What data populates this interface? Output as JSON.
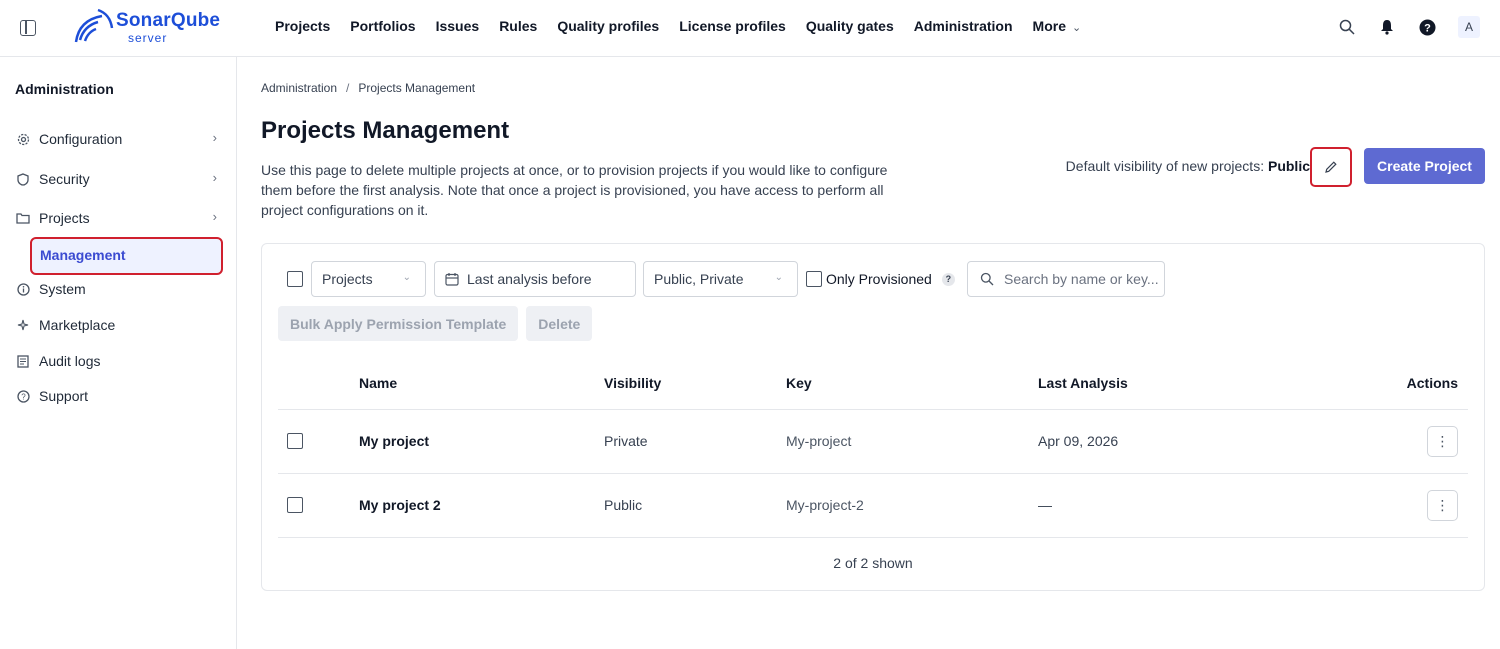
{
  "header": {
    "logo_text": "SonarQube",
    "logo_sub": "server",
    "nav": [
      "Projects",
      "Portfolios",
      "Issues",
      "Rules",
      "Quality profiles",
      "License profiles",
      "Quality gates",
      "Administration"
    ],
    "more_label": "More",
    "avatar_letter": "A"
  },
  "sidebar": {
    "title": "Administration",
    "items": [
      {
        "label": "Configuration",
        "icon": "gear-icon"
      },
      {
        "label": "Security",
        "icon": "shield-icon"
      },
      {
        "label": "Projects",
        "icon": "folder-icon"
      },
      {
        "label": "System",
        "icon": "info-icon"
      },
      {
        "label": "Marketplace",
        "icon": "sparkle-icon"
      },
      {
        "label": "Audit logs",
        "icon": "log-icon"
      },
      {
        "label": "Support",
        "icon": "help-icon"
      }
    ],
    "active_sub": "Management"
  },
  "main": {
    "breadcrumb": [
      "Administration",
      "Projects Management"
    ],
    "title": "Projects Management",
    "description": "Use this page to delete multiple projects at once, or to provision projects if you would like to configure them before the first analysis. Note that once a project is provisioned, you have access to perform all project configurations on it.",
    "visibility_label": "Default visibility of new projects:",
    "visibility_value": "Public",
    "create_button": "Create Project"
  },
  "filters": {
    "qualifier": "Projects",
    "date_placeholder": "Last analysis before",
    "visibility": "Public, Private",
    "only_provisioned": "Only Provisioned",
    "help_badge": "?",
    "search_placeholder": "Search by name or key..."
  },
  "actions": {
    "bulk_apply": "Bulk Apply Permission Template",
    "delete": "Delete"
  },
  "table": {
    "headers": [
      "Name",
      "Visibility",
      "Key",
      "Last Analysis",
      "Actions"
    ],
    "rows": [
      {
        "name": "My project",
        "visibility": "Private",
        "key": "My-project",
        "last_analysis": "Apr 09, 2026"
      },
      {
        "name": "My project 2",
        "visibility": "Public",
        "key": "My-project-2",
        "last_analysis": "—"
      }
    ],
    "footer": "2 of 2 shown"
  },
  "colors": {
    "accent": "#5e6ad2",
    "highlight_border": "#d0202e",
    "logo": "#1d4ed8"
  }
}
